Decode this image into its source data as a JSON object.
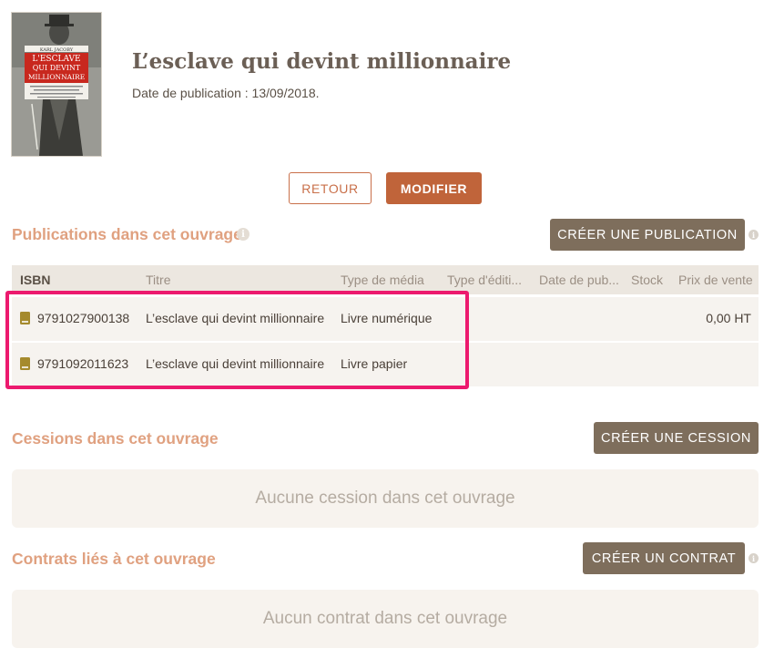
{
  "book": {
    "cover_author": "KARL JACOBY",
    "cover_title_line1": "L'ESCLAVE",
    "cover_title_line2": "QUI DEVINT",
    "cover_title_line3": "MILLIONNAIRE",
    "title": "L’esclave qui devint millionnaire",
    "publication_date": "Date de publication : 13/09/2018."
  },
  "actions": {
    "back_label": "RETOUR",
    "edit_label": "MODIFIER"
  },
  "publications": {
    "section_title": "Publications dans cet ouvrage",
    "create_label": "CRÉER UNE PUBLICATION",
    "columns": [
      "ISBN",
      "Titre",
      "Type de média",
      "Type d'éditi...",
      "Date de pub...",
      "Stock",
      "Prix de vente"
    ],
    "rows": [
      {
        "isbn": "9791027900138",
        "titre": "L’esclave qui devint millionnaire",
        "type_media": "Livre numérique",
        "type_edition": "",
        "date_pub": "",
        "stock": "",
        "prix": "0,00 HT"
      },
      {
        "isbn": "9791092011623",
        "titre": "L’esclave qui devint millionnaire",
        "type_media": "Livre papier",
        "type_edition": "",
        "date_pub": "",
        "stock": "",
        "prix": ""
      }
    ]
  },
  "cessions": {
    "section_title": "Cessions dans cet ouvrage",
    "create_label": "CRÉER UNE CESSION",
    "empty_text": "Aucune cession dans cet ouvrage"
  },
  "contrats": {
    "section_title": "Contrats liés à cet ouvrage",
    "create_label": "CRÉER UN CONTRAT",
    "empty_text": "Aucun contrat dans cet ouvrage"
  },
  "icons": {
    "info": "info-icon",
    "book": "book-icon"
  },
  "colors": {
    "accent": "#c0643a",
    "section_title": "#e0a180",
    "dark_button": "#7e6e5c",
    "highlight": "#ec1a6e",
    "book_icon": "#a58a2d"
  }
}
